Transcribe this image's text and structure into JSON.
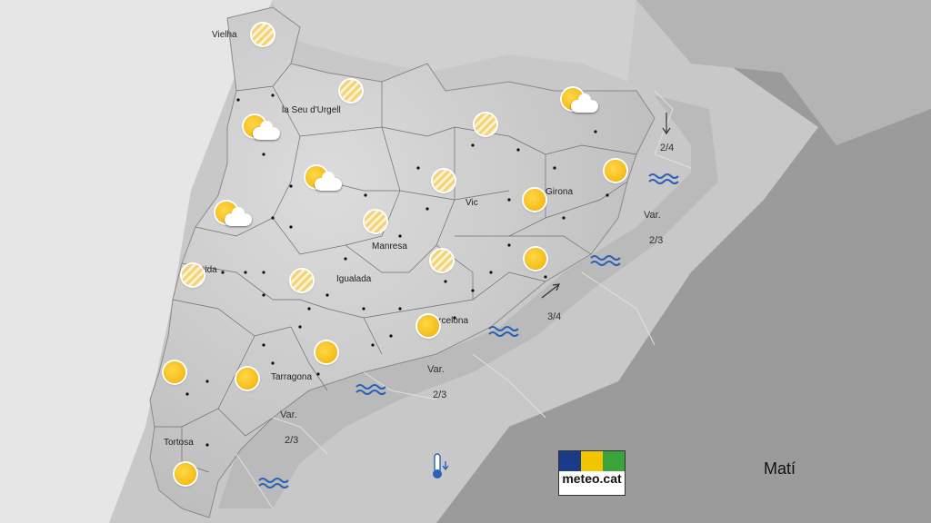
{
  "cities": [
    {
      "name": "Vielha"
    },
    {
      "name": "la Seu d'Urgell"
    },
    {
      "name": "Vic"
    },
    {
      "name": "Girona"
    },
    {
      "name": "Manresa"
    },
    {
      "name": "Igualada"
    },
    {
      "name": "Barcelona"
    },
    {
      "name": "Tarragona"
    },
    {
      "name": "Tortosa"
    },
    {
      "name": "Lleida"
    }
  ],
  "sea_states": [
    {
      "label": "2/4"
    },
    {
      "label": "Var."
    },
    {
      "label": "2/3"
    },
    {
      "label": "3/4"
    },
    {
      "label": "Var."
    },
    {
      "label": "2/3"
    },
    {
      "label": "Var."
    },
    {
      "label": "2/3"
    }
  ],
  "weather_icons": [
    "haze-sun",
    "haze-sun",
    "sun-cloud",
    "sun-cloud",
    "haze-sun",
    "sun-cloud",
    "sun",
    "sun-cloud",
    "haze-sun",
    "haze-sun",
    "sun",
    "haze-sun",
    "haze-sun",
    "sun",
    "sun",
    "sun",
    "sun",
    "sun",
    "sun",
    "haze-sun"
  ],
  "logo": {
    "text": "meteo.cat",
    "colors": [
      "#1a3a8a",
      "#f3c500",
      "#3aa33a"
    ]
  },
  "period": "Matí",
  "temperature_trend": "thermometer-down-icon",
  "colors": {
    "sea_wave": "#2b62b6",
    "sun": "#f3b800"
  }
}
